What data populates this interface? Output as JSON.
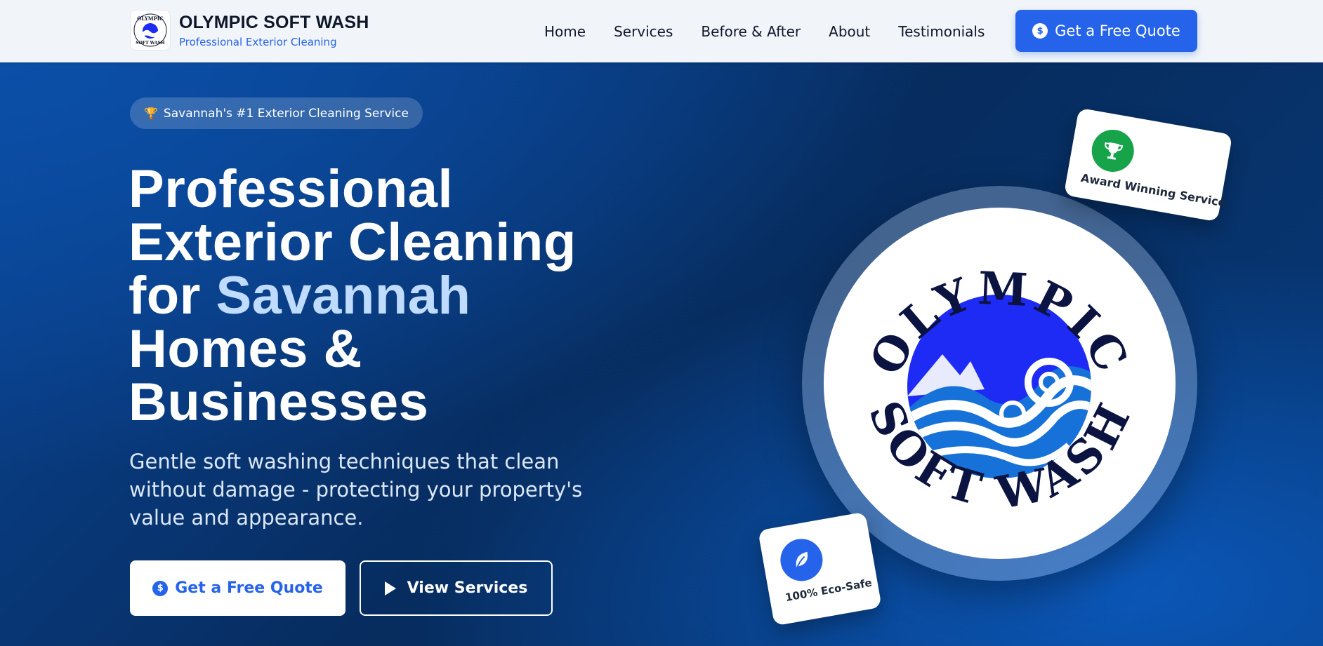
{
  "header": {
    "brand_title": "OLYMPIC SOFT WASH",
    "brand_tagline": "Professional Exterior Cleaning",
    "nav": [
      "Home",
      "Services",
      "Before & After",
      "About",
      "Testimonials"
    ],
    "cta_label": "Get a Free Quote"
  },
  "hero": {
    "badge_icon": "trophy-icon",
    "badge_text": "Savannah's #1 Exterior Cleaning Service",
    "headline_line1": "Professional",
    "headline_line2": "Exterior Cleaning",
    "headline_for": "for ",
    "headline_highlight": "Savannah",
    "headline_line4": "Homes &",
    "headline_line5": "Businesses",
    "lead": "Gentle soft washing techniques that clean without damage - protecting your property's value and appearance.",
    "primary_cta": "Get a Free Quote",
    "secondary_cta": "View Services"
  },
  "logo": {
    "top_text": "OLYMPIC",
    "bottom_text": "SOFT WASH"
  },
  "cards": {
    "award_label": "Award Winning Service",
    "eco_label": "100% Eco-Safe"
  },
  "colors": {
    "accent": "#2563eb",
    "highlight": "#bfdbfe",
    "award_green": "#16a34a",
    "hero_dark": "#072c5e"
  }
}
